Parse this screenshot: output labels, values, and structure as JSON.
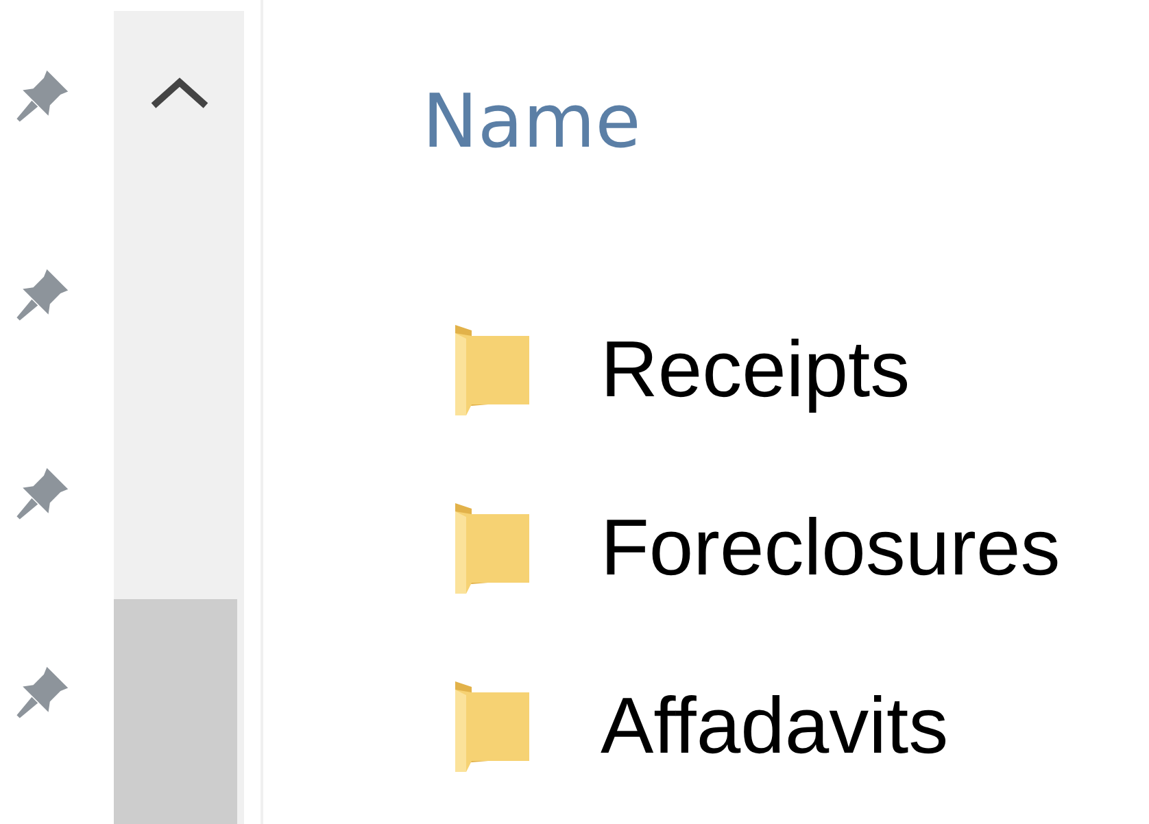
{
  "quick_access": [
    {
      "pinned": true
    },
    {
      "pinned": true
    },
    {
      "pinned": true
    },
    {
      "pinned": true
    }
  ],
  "scrollbar": {
    "up_button": true
  },
  "column_header": "Name",
  "files": [
    {
      "name": "Receipts",
      "kind": "folder"
    },
    {
      "name": "Foreclosures",
      "kind": "folder"
    },
    {
      "name": "Affadavits",
      "kind": "folder"
    }
  ]
}
